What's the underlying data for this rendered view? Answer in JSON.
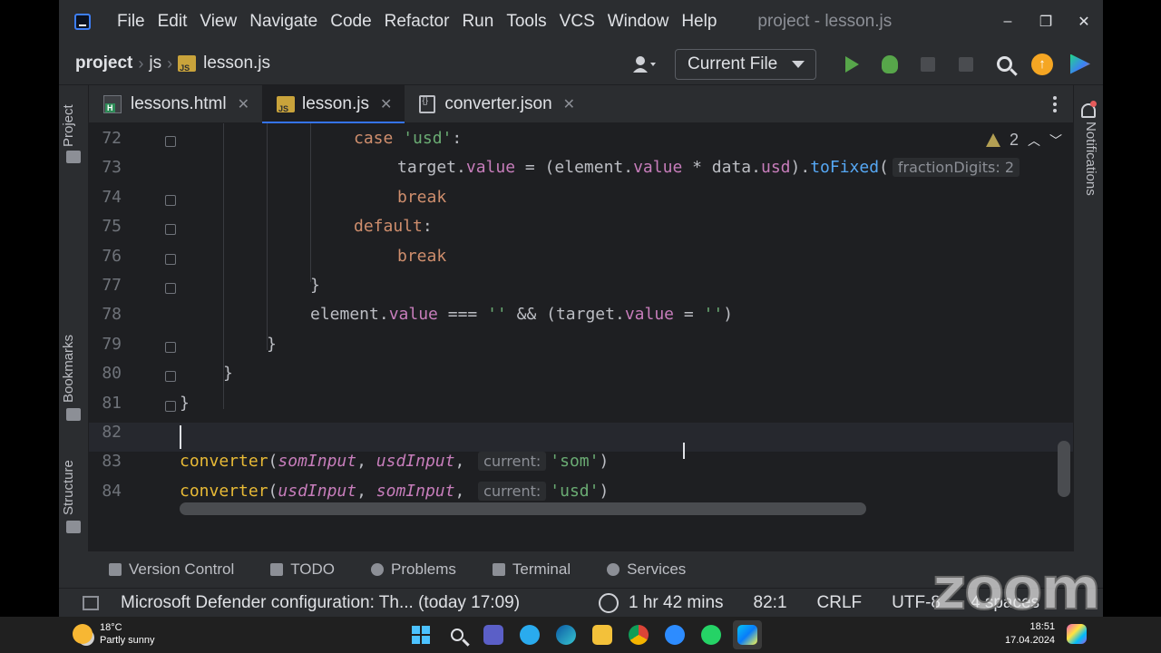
{
  "titlebar": {
    "menu": [
      "File",
      "Edit",
      "View",
      "Navigate",
      "Code",
      "Refactor",
      "Run",
      "Tools",
      "VCS",
      "Window",
      "Help"
    ],
    "window_title": "project - lesson.js",
    "controls": [
      "–",
      "❐",
      "✕"
    ]
  },
  "navbar": {
    "breadcrumbs": [
      "project",
      "js",
      "lesson.js"
    ],
    "run_config": "Current File",
    "icons": [
      "user-icon",
      "run-icon",
      "debug-icon",
      "coverage-icon",
      "stop-icon",
      "search-icon",
      "update-icon",
      "ide-logo-icon"
    ]
  },
  "left_stripe": {
    "project": "Project",
    "bookmarks": "Bookmarks",
    "structure": "Structure"
  },
  "right_stripe": {
    "notifications": "Notifications"
  },
  "tabs": [
    {
      "label": "lessons.html",
      "icon": "html-file-icon",
      "active": false
    },
    {
      "label": "lesson.js",
      "icon": "js-file-icon",
      "active": true
    },
    {
      "label": "converter.json",
      "icon": "json-file-icon",
      "active": false
    }
  ],
  "inspection": {
    "warnings": "2"
  },
  "editor": {
    "line_numbers": [
      "72",
      "73",
      "74",
      "75",
      "76",
      "77",
      "78",
      "79",
      "80",
      "81",
      "82",
      "83",
      "84"
    ],
    "current_line": "82",
    "hints": {
      "fraction": "fractionDigits:",
      "fraction_value": "2",
      "current": "current:"
    }
  },
  "tool_windows": [
    "Version Control",
    "TODO",
    "Problems",
    "Terminal",
    "Services"
  ],
  "statusbar": {
    "message": "Microsoft Defender configuration: Th... (today 17:09)",
    "time_spent": "1 hr 42 mins",
    "position": "82:1",
    "line_sep": "CRLF",
    "encoding": "UTF-8",
    "indent": "4 spaces"
  },
  "watermark": "zoom",
  "taskbar": {
    "temperature": "18°C",
    "weather": "Partly sunny",
    "time": "18:51",
    "date": "17.04.2024",
    "apps": [
      "windows-start-icon",
      "search-icon",
      "teams-icon",
      "telegram-icon",
      "edge-icon",
      "explorer-icon",
      "chrome-icon",
      "zoom-icon",
      "whatsapp-icon",
      "webstorm-icon"
    ]
  },
  "colors": {
    "editor_bg": "#1e1f22",
    "keyword": "#cf8e6d",
    "string": "#6aab73",
    "property": "#c77dbb",
    "function": "#56a8f5",
    "accent": "#3574f0"
  }
}
